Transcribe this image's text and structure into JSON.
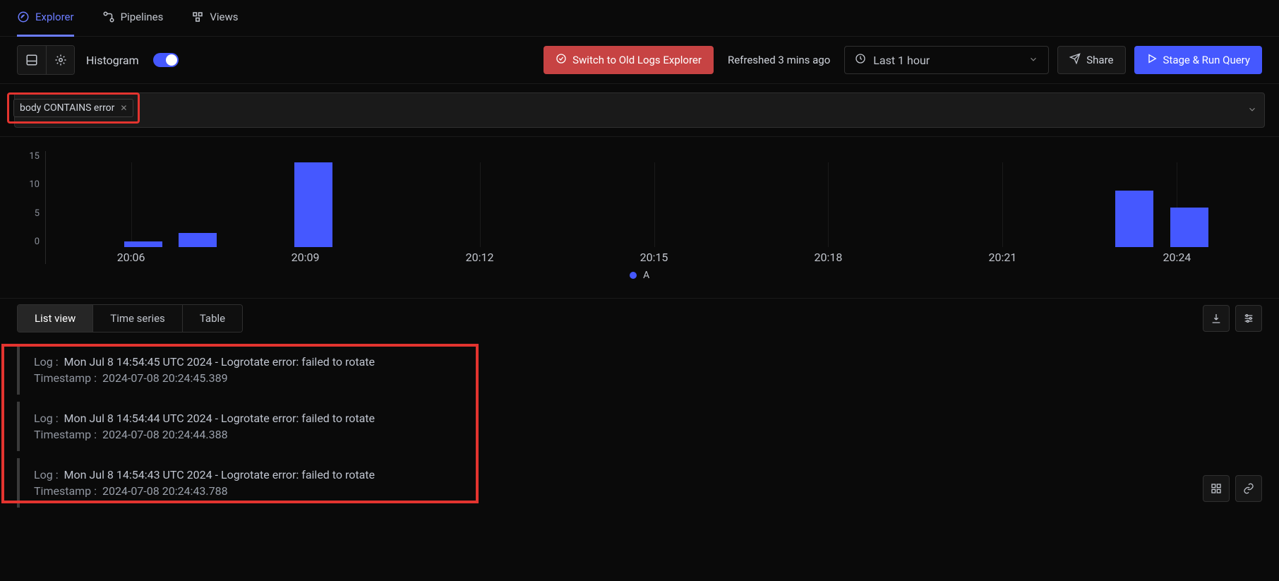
{
  "topTabs": [
    {
      "label": "Explorer",
      "icon": "compass",
      "active": true
    },
    {
      "label": "Pipelines",
      "icon": "pipeline",
      "active": false
    },
    {
      "label": "Views",
      "icon": "views",
      "active": false
    }
  ],
  "toolbar": {
    "histogram_label": "Histogram",
    "histogram_on": true,
    "switch_label": "Switch to Old Logs Explorer",
    "refreshed_label": "Refreshed 3 mins ago",
    "time_range": "Last 1 hour",
    "share_label": "Share",
    "run_label": "Stage & Run Query"
  },
  "filter": {
    "chip_text": "body CONTAINS error"
  },
  "chart_data": {
    "type": "bar",
    "y_ticks": [
      15,
      10,
      5,
      0
    ],
    "x_ticks": [
      "20:06",
      "20:09",
      "20:12",
      "20:15",
      "20:18",
      "20:21",
      "20:24"
    ],
    "series_name": "A",
    "bars": [
      {
        "x_pct": 8,
        "h": 1
      },
      {
        "x_pct": 12.5,
        "h": 2.5
      },
      {
        "x_pct": 22,
        "h": 15
      },
      {
        "x_pct": 89.5,
        "h": 10
      },
      {
        "x_pct": 94,
        "h": 7
      }
    ],
    "y_max": 15
  },
  "viewTabs": [
    {
      "label": "List view",
      "active": true
    },
    {
      "label": "Time series",
      "active": false
    },
    {
      "label": "Table",
      "active": false
    }
  ],
  "logs": [
    {
      "log": "Mon Jul 8 14:54:45 UTC 2024 - Logrotate error: failed to rotate",
      "ts": "2024-07-08 20:24:45.389"
    },
    {
      "log": "Mon Jul 8 14:54:44 UTC 2024 - Logrotate error: failed to rotate",
      "ts": "2024-07-08 20:24:44.388"
    },
    {
      "log": "Mon Jul 8 14:54:43 UTC 2024 - Logrotate error: failed to rotate",
      "ts": "2024-07-08 20:24:43.788"
    }
  ],
  "labels": {
    "log_prefix": "Log :",
    "ts_prefix": "Timestamp :"
  }
}
